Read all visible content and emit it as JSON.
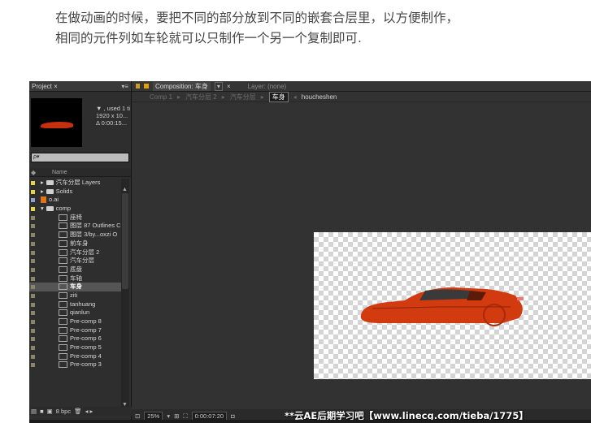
{
  "caption": {
    "line1": "在做动画的时候，要把不同的部分放到不同的嵌套合层里，以方便制作，",
    "line2": "相同的元件列如车轮就可以只制作一个另一个复制即可."
  },
  "project_panel": {
    "tab_label": "Project ×",
    "menu_glyph": "▾≡",
    "info_line1": "▼ , used 1 ti",
    "info_line2": "1920 x 10...",
    "info_line3": "Δ 0:00:15...",
    "search_placeholder": "ρ▾",
    "column_name": "Name",
    "footer_bpc": "8 bpc",
    "items": [
      {
        "label": "汽车分层 Layers",
        "type": "folder",
        "swatch": "#e7d34a",
        "indent": 0
      },
      {
        "label": "Solids",
        "type": "folder",
        "swatch": "#e7d34a",
        "indent": 0
      },
      {
        "label": "o.ai",
        "type": "ai",
        "swatch": "#8fa2c8",
        "indent": 0
      },
      {
        "label": "comp",
        "type": "folder-open",
        "swatch": "#e7d34a",
        "indent": 0
      },
      {
        "label": "座椅",
        "type": "comp",
        "swatch": "#8a8468",
        "indent": 1
      },
      {
        "label": "图层 87 Outlines C",
        "type": "comp",
        "swatch": "#8a8468",
        "indent": 1
      },
      {
        "label": "图层 3/by...oxzi O",
        "type": "comp",
        "swatch": "#8a8468",
        "indent": 1
      },
      {
        "label": "前车身",
        "type": "comp",
        "swatch": "#8a8468",
        "indent": 1
      },
      {
        "label": "汽车分层 2",
        "type": "comp",
        "swatch": "#8a8468",
        "indent": 1
      },
      {
        "label": "汽车分层",
        "type": "comp",
        "swatch": "#8a8468",
        "indent": 1
      },
      {
        "label": "底盘",
        "type": "comp",
        "swatch": "#8a8468",
        "indent": 1
      },
      {
        "label": "车轴",
        "type": "comp",
        "swatch": "#8a8468",
        "indent": 1
      },
      {
        "label": "车身",
        "type": "comp",
        "swatch": "#8a8468",
        "indent": 1,
        "selected": true
      },
      {
        "label": "ziti",
        "type": "comp",
        "swatch": "#8a8468",
        "indent": 1
      },
      {
        "label": "tanhuang",
        "type": "comp",
        "swatch": "#8a8468",
        "indent": 1
      },
      {
        "label": "qianlun",
        "type": "comp",
        "swatch": "#8a8468",
        "indent": 1
      },
      {
        "label": "Pre-comp 8",
        "type": "comp",
        "swatch": "#8a8468",
        "indent": 1
      },
      {
        "label": "Pre-comp 7",
        "type": "comp",
        "swatch": "#8a8468",
        "indent": 1
      },
      {
        "label": "Pre-comp 6",
        "type": "comp",
        "swatch": "#8a8468",
        "indent": 1
      },
      {
        "label": "Pre-comp 5",
        "type": "comp",
        "swatch": "#8a8468",
        "indent": 1
      },
      {
        "label": "Pre-comp 4",
        "type": "comp",
        "swatch": "#8a8468",
        "indent": 1
      },
      {
        "label": "Pre-comp 3",
        "type": "comp",
        "swatch": "#8a8468",
        "indent": 1
      }
    ]
  },
  "comp_panel": {
    "tab_label": "Composition: 车身",
    "tab_dropdown": "▾",
    "close": "×",
    "layer_tab": "Layer: (none)",
    "breadcrumbs": [
      "Comp 1",
      "汽车分层 2",
      "汽车分层",
      "车身",
      "houcheshen"
    ],
    "active_crumb_index": 3,
    "footer": {
      "zoom": "25%",
      "timecode": "0:00:07:20"
    }
  },
  "watermark": "**云AE后期学习吧【www.linecg.com/tieba/1775】",
  "colors": {
    "car_body": "#d23a10",
    "selection": "#555555"
  }
}
